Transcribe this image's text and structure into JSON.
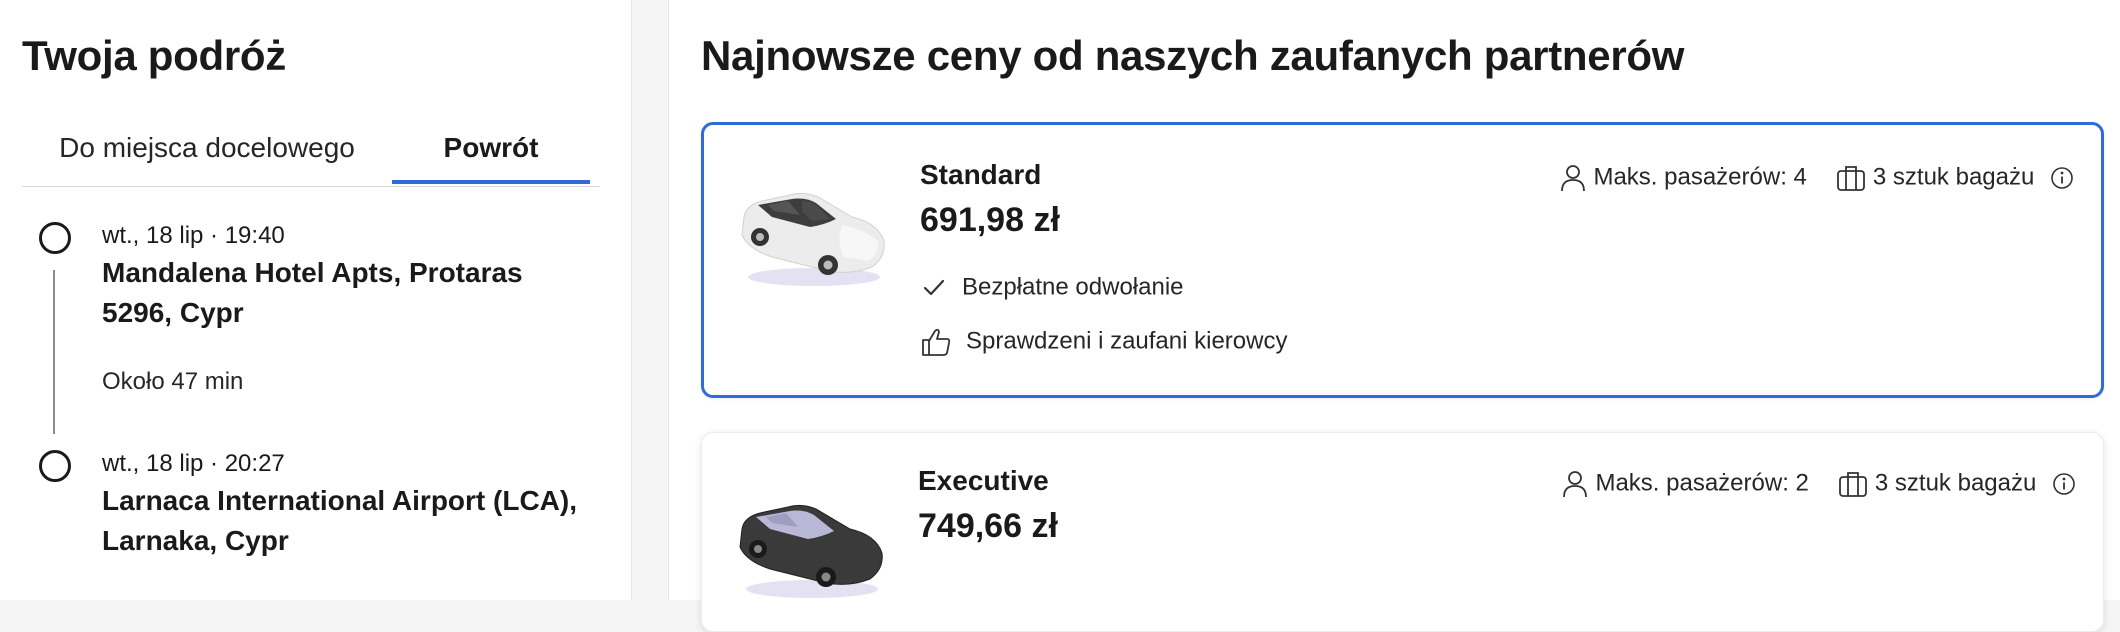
{
  "trip": {
    "title": "Twoja podróż",
    "tabs": [
      {
        "label": "Do miejsca docelowego",
        "active": false
      },
      {
        "label": "Powrót",
        "active": true
      }
    ],
    "departure": {
      "time": "wt., 18 lip · 19:40",
      "place": "Mandalena Hotel Apts, Protaras 5296, Cypr"
    },
    "duration": "Około 47 min",
    "arrival": {
      "time": "wt., 18 lip · 20:27",
      "place": "Larnaca International Airport (LCA), Larnaka, Cypr"
    }
  },
  "offers": {
    "title": "Najnowsze ceny od naszych zaufanych partnerów",
    "cards": [
      {
        "name": "Standard",
        "price": "691,98 zł",
        "passengers": "Maks. pasażerów: 4",
        "luggage": "3 sztuk bagażu",
        "features": [
          "Bezpłatne odwołanie",
          "Sprawdzeni i zaufani kierowcy"
        ],
        "car_color": "white",
        "selected": true
      },
      {
        "name": "Executive",
        "price": "749,66 zł",
        "passengers": "Maks. pasażerów: 2",
        "luggage": "3 sztuk bagażu",
        "car_color": "black",
        "selected": false
      }
    ]
  },
  "colors": {
    "accent": "#2f6bd9",
    "text": "#1a1a1a",
    "border": "#e6e6e6"
  },
  "icons": [
    "user-icon",
    "luggage-icon",
    "info-icon",
    "check-icon",
    "thumbs-up-icon",
    "car-image"
  ]
}
